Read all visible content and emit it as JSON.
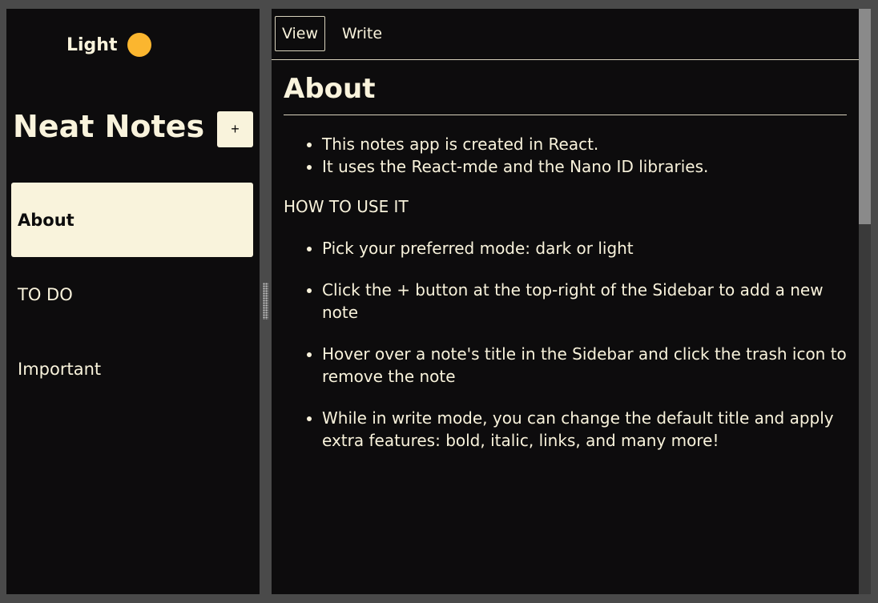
{
  "sidebar": {
    "mode_label": "Light",
    "mode_dot_color": "#fbb62f",
    "title": "Neat Notes",
    "add_label": "+",
    "notes": [
      {
        "label": "About",
        "active": true
      },
      {
        "label": "TO DO",
        "active": false
      },
      {
        "label": "Important",
        "active": false
      }
    ]
  },
  "tabs": {
    "view_label": "View",
    "write_label": "Write"
  },
  "note": {
    "title": "About",
    "intro_bullets": [
      "This notes app is created in React.",
      "It uses the React-mde and the Nano ID libraries."
    ],
    "section_label": "HOW TO USE IT",
    "howto_bullets": [
      "Pick your preferred mode: dark or light",
      "Click the + button at the top-right of the Sidebar to add a new note",
      "Hover over a note's title in the Sidebar and click the trash icon to remove the note",
      "While in write mode, you can change the default title and apply extra features: bold, italic, links, and many more!"
    ]
  },
  "colors": {
    "background": "#0d0c0d",
    "text": "#f9f3dc",
    "accent": "#fbb62f",
    "frame": "#4a4a4a"
  }
}
